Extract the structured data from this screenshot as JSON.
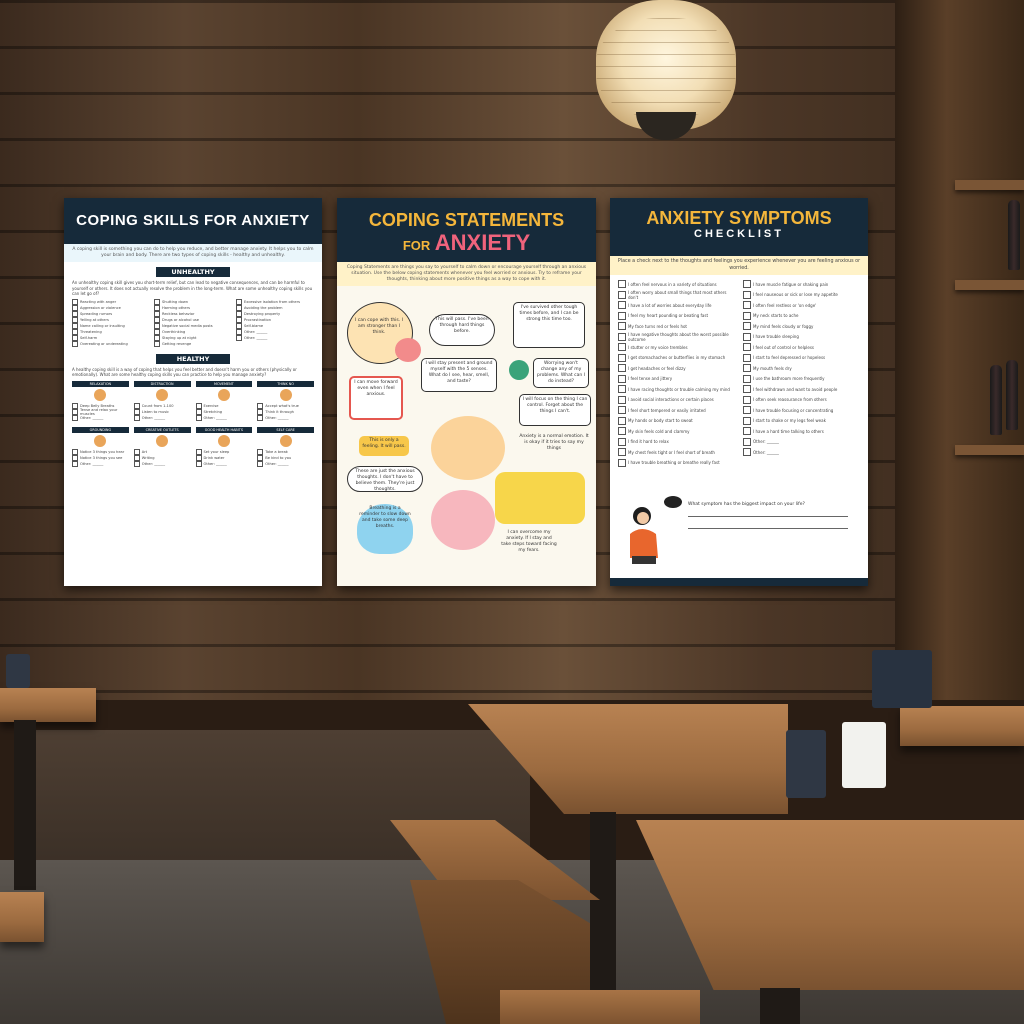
{
  "poster_left": {
    "title": "COPING SKILLS FOR ANXIETY",
    "intro": "A coping skill is something you can do to help you reduce, and better manage anxiety. It helps you to calm your brain and body. There are two types of coping skills - healthy and unhealthy.",
    "unhealthy_heading": "UNHEALTHY",
    "unhealthy_text": "An unhealthy coping skill gives you short-term relief, but can lead to negative consequences, and can be harmful to yourself or others. It does not actually resolve the problem in the long-term. What are some unhealthy coping skills you can let go of?",
    "unhealthy_items": [
      [
        "Reacting with anger",
        "Aggression or violence",
        "Spreading rumors",
        "Yelling at others",
        "Name calling or insulting",
        "Threatening",
        "Self-harm",
        "Overeating or undereating"
      ],
      [
        "Shutting down",
        "Harming others",
        "Reckless behavior",
        "Drugs or alcohol use",
        "Negative social media posts",
        "Overthinking",
        "Staying up at night",
        "Getting revenge"
      ],
      [
        "Excessive isolation from others",
        "Avoiding the problem",
        "Destroying property",
        "Procrastination",
        "Self-blame",
        "Other: ______",
        "Other: ______",
        ""
      ]
    ],
    "healthy_heading": "HEALTHY",
    "healthy_text": "A healthy coping skill is a way of coping that helps you feel better and doesn't harm you or others (physically or emotionally). What are some healthy coping skills you can practice to help you manage anxiety?",
    "categories_row1": [
      "RELAXATION",
      "DISTRACTION",
      "MOVEMENT",
      "THINK NO"
    ],
    "categories_row2": [
      "GROUNDING",
      "CREATIVE OUTLETS",
      "GOOD HEALTH HABITS",
      "SELF CARE"
    ],
    "category_items": [
      "Deep Belly Breaths",
      "Tense and relax your muscles",
      "Other: ______",
      "Count from 1-100",
      "Listen to music",
      "Other: ______",
      "Exercise",
      "Stretching",
      "Other: ______",
      "Accept what's true",
      "Think it through",
      "Other: ______"
    ],
    "category_items_row2": [
      "Notice 3 things you hear",
      "Notice 3 things you see",
      "Other: ______",
      "Art",
      "Writing",
      "Other: ______",
      "Set your sleep",
      "Drink water",
      "Other: ______",
      "Take a break",
      "Be kind to you",
      "Other: ______"
    ]
  },
  "poster_center": {
    "title_line1": "COPING STATEMENTS",
    "title_for": "FOR",
    "title_line2": "ANXIETY",
    "intro": "Coping Statements are things you say to yourself to calm down or encourage yourself through an anxious situation. Use the below coping statements whenever you feel worried or anxious. Try to reframe your thoughts, thinking about more positive things as a way to cope with it.",
    "statements": [
      "I can cope with this. I am stronger than I think.",
      "This will pass. I've been through hard things before.",
      "I've survived other tough times before, and I can be strong this time too.",
      "I can move forward even when I feel anxious.",
      "I will stay present and ground myself with the 5 senses. What do I see, hear, smell, and taste?",
      "Worrying won't change any of my problems. What can I do instead?",
      "I will focus on the thing I can control. Forget about the things I can't.",
      "This is only a feeling. It will pass.",
      "Anxiety is a normal emotion. It is okay if it tries to say my things",
      "These are just the anxious thoughts. I don't have to believe them. They're just thoughts.",
      "Breathing is a reminder to slow down and take some deep breaths.",
      "I can overcome my anxiety. If I stay and take steps toward facing my fears."
    ]
  },
  "poster_right": {
    "title_line1": "ANXIETY SYMPTOMS",
    "title_line2": "CHECKLIST",
    "intro": "Place a check next to the thoughts and feelings you experience whenever you are feeling anxious or worried.",
    "items_left": [
      "I often feel nervous in a variety of situations",
      "I often worry about small things that most others don't",
      "I have a lot of worries about everyday life",
      "I feel my heart pounding or beating fast",
      "My face turns red or feels hot",
      "I have negative thoughts about the worst possible outcome",
      "I stutter or my voice trembles",
      "I get stomachaches or butterflies in my stomach",
      "I get headaches or feel dizzy",
      "I feel tense and jittery",
      "I have racing thoughts or trouble calming my mind",
      "I avoid social interactions or certain places",
      "I feel short tempered or easily irritated",
      "My hands or body start to sweat",
      "My skin feels cold and clammy",
      "I find it hard to relax",
      "My chest feels tight or I feel short of breath",
      "I have trouble breathing or breathe really fast"
    ],
    "items_right": [
      "I have muscle fatigue or shaking pain",
      "I feel nauseous or sick or lose my appetite",
      "I often feel restless or 'on edge'",
      "My neck starts to ache",
      "My mind feels cloudy or foggy",
      "I have trouble sleeping",
      "I feel out of control or helpless",
      "I start to feel depressed or hopeless",
      "My mouth feels dry",
      "I use the bathroom more frequently",
      "I feel withdrawn and want to avoid people",
      "I often seek reassurance from others",
      "I have trouble focusing or concentrating",
      "I start to shake or my legs feel weak",
      "I have a hard time talking to others",
      "Other: ______",
      "Other: ______"
    ],
    "question": "What symptom has the biggest impact on your life?"
  },
  "colors": {
    "navy": "#162a3a",
    "yellow": "#f4b63b",
    "pink": "#f0637c",
    "wood": "#9c6b40"
  }
}
